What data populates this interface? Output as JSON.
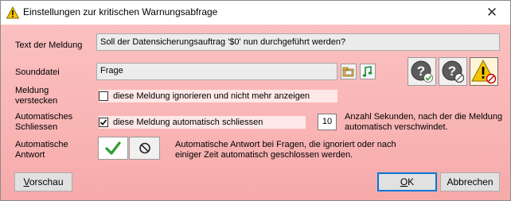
{
  "window": {
    "title": "Einstellungen zur kritischen Warnungsabfrage",
    "close_glyph": "✕"
  },
  "message": {
    "label": "Text der Meldung",
    "value": "Soll der Datensicherungsauftrag '$0' nun durchgeführt werden?"
  },
  "sound": {
    "label": "Sounddatei",
    "value": "Frage",
    "browse_icon": "folder-browse-icon",
    "play_icon": "play-sound-icon"
  },
  "icon_choices": [
    {
      "name": "question-check-icon",
      "selected": false
    },
    {
      "name": "question-forbidden-icon",
      "selected": false
    },
    {
      "name": "warning-forbidden-icon",
      "selected": true
    }
  ],
  "hide": {
    "label_line1": "Meldung",
    "label_line2": "verstecken",
    "checkbox_label": "diese Meldung ignorieren und nicht mehr anzeigen",
    "checked": false
  },
  "autoclose": {
    "label_line1": "Automatisches",
    "label_line2": "Schliessen",
    "checkbox_label": "diese Meldung automatisch schliessen",
    "checked": true,
    "seconds": "10",
    "desc_line1": "Anzahl Sekunden, nach der die Meldung",
    "desc_line2": "automatisch verschwindet."
  },
  "autoanswer": {
    "label_line1": "Automatische",
    "label_line2": "Antwort",
    "yes_icon": "checkmark-icon",
    "no_icon": "no-entry-icon",
    "desc_line1": "Automatische Antwort bei Fragen, die ignoriert oder nach",
    "desc_line2": "einiger Zeit automatisch geschlossen werden."
  },
  "buttons": {
    "preview_underlined": "V",
    "preview_rest": "orschau",
    "ok_underlined": "O",
    "ok_rest": "K",
    "cancel": "Abbrechen"
  },
  "colors": {
    "background": "#f9b4b4",
    "default_button_border": "#0078d7",
    "check_green": "#2e9e2e"
  }
}
